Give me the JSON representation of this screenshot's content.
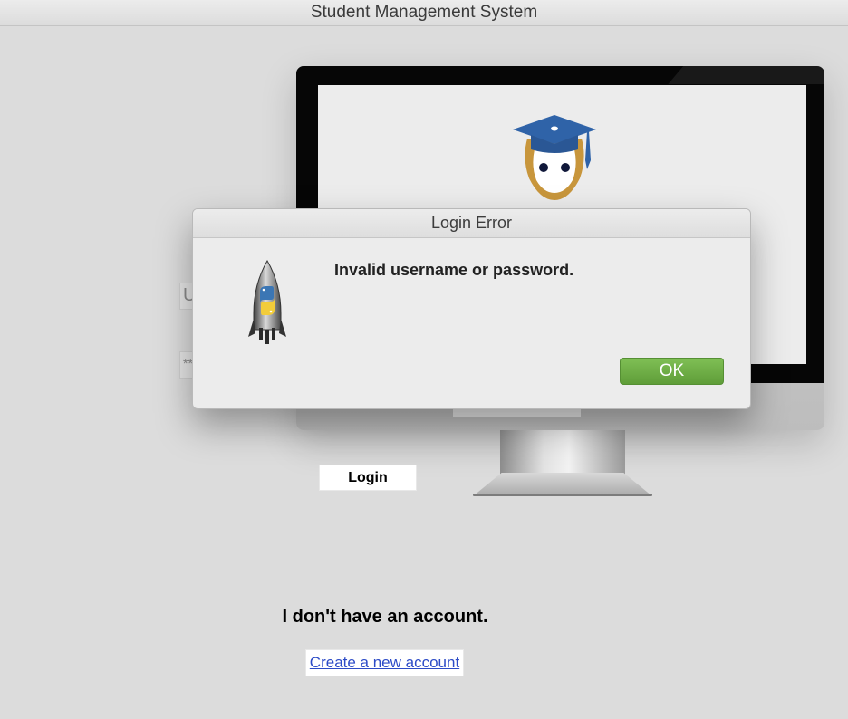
{
  "window": {
    "title": "Student Management System"
  },
  "background": {
    "username_placeholder": "Username",
    "password_value": "********",
    "login_label": "Login",
    "no_account_text": "I don't have an account.",
    "create_account_label": "Create a new account"
  },
  "dialog": {
    "title": "Login Error",
    "message": "Invalid username or password.",
    "ok_label": "OK",
    "icon": "python-rocket-icon"
  },
  "colors": {
    "ok_button": "#6aaa44",
    "link": "#2c4bc7",
    "logo_cap": "#2f63a8",
    "logo_face": "#c8963c"
  }
}
